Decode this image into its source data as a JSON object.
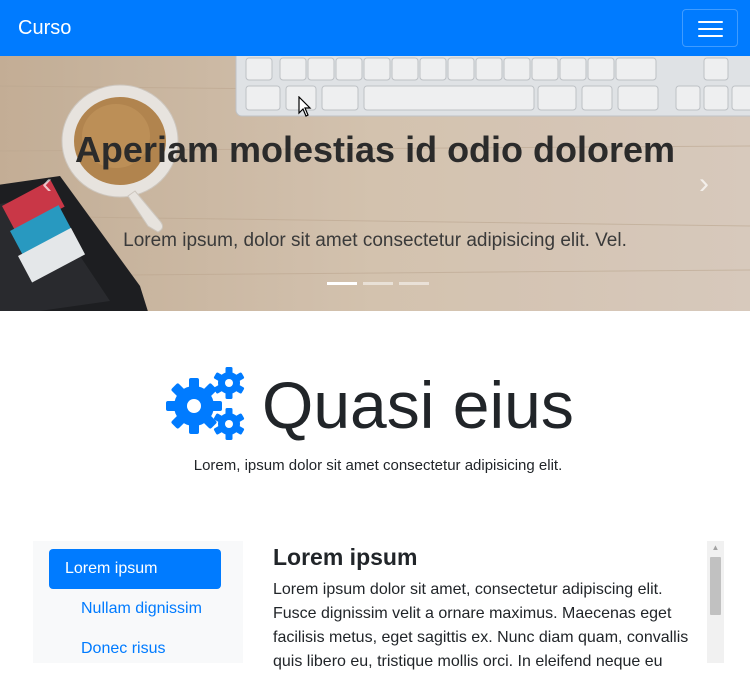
{
  "navbar": {
    "brand": "Curso",
    "brand_color": "#007bff"
  },
  "carousel": {
    "title": "Aperiam molestias id odio dolorem",
    "text": "Lorem ipsum, dolor sit amet consectetur adipisicing elit. Vel.",
    "prev_icon": "chevron-left-icon",
    "next_icon": "chevron-right-icon",
    "indicators": [
      {
        "active": true
      },
      {
        "active": false
      },
      {
        "active": false
      }
    ]
  },
  "section": {
    "icon": "gears-icon",
    "title": "Quasi eius",
    "subtitle": "Lorem, ipsum dolor sit amet consectetur adipisicing elit."
  },
  "sidebar": {
    "items": [
      {
        "label": "Lorem ipsum",
        "active": true
      },
      {
        "label": "Nullam dignissim",
        "active": false
      },
      {
        "label": "Donec risus",
        "active": false
      }
    ]
  },
  "content": {
    "title": "Lorem ipsum",
    "lines": [
      "Lorem ipsum dolor sit amet, consectetur adipiscing elit.",
      "Fusce dignissim velit a ornare maximus. Maecenas eget",
      "facilisis metus, eget sagittis ex. Nunc diam quam, convallis",
      "quis libero eu, tristique mollis orci. In eleifend neque eu"
    ]
  }
}
